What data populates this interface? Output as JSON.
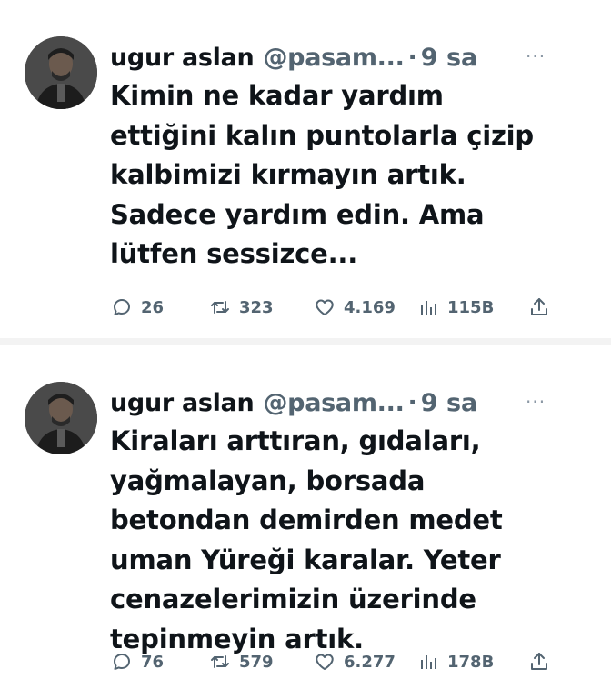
{
  "tweets": [
    {
      "author_name": "ugur aslan",
      "handle": "@pasam...",
      "separator": "·",
      "time": "9 sa",
      "more": "···",
      "lines": [
        "Kimin ne kadar yardım",
        "ettiğini kalın puntolarla çizip",
        "kalbimizi kırmayın artık.",
        "Sadece yardım edin. Ama",
        "lütfen sessizce..."
      ],
      "replies": "26",
      "retweets": "323",
      "likes": "4.169",
      "views": "115B"
    },
    {
      "author_name": "ugur aslan",
      "handle": "@pasam...",
      "separator": "·",
      "time": "9 sa",
      "more": "···",
      "lines": [
        "Kiraları arttıran, gıdaları,",
        "yağmalayan, borsada",
        "betondan demirden medet",
        "uman Yüreği karalar. Yeter",
        "cenazelerimizin üzerinde",
        "tepinmeyin artık."
      ],
      "replies": "76",
      "retweets": "579",
      "likes": "6.277",
      "views": "178B"
    }
  ],
  "icons": {
    "reply": "speech-bubble-icon",
    "retweet": "retweet-icon",
    "like": "heart-icon",
    "views": "bar-chart-icon",
    "share": "share-icon"
  },
  "colors": {
    "text": "#0f1419",
    "secondary": "#536471",
    "divider": "#f3f3f3"
  }
}
